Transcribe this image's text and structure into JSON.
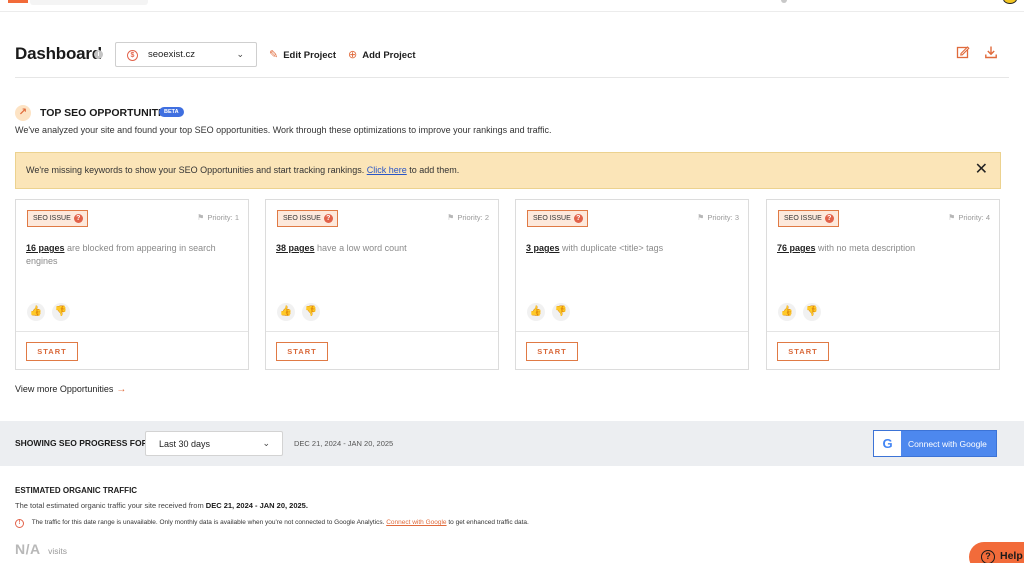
{
  "header": {
    "title": "Dashboard",
    "info_icon": "info-icon",
    "project": {
      "value": "seoexist.cz",
      "icon": "site-favicon-icon"
    },
    "edit_project": "Edit Project",
    "add_project": "Add Project",
    "report_icon": "edit-report-icon",
    "download_icon": "download-icon"
  },
  "opportunities": {
    "title": "TOP SEO OPPORTUNITIES",
    "beta": "BETA",
    "subtitle": "We've analyzed your site and found your top SEO opportunities. Work through these optimizations to improve your rankings and traffic.",
    "alert": {
      "text_before": "We're missing keywords to show your SEO Opportunities and start tracking rankings.",
      "link": "Click here",
      "text_after": "to add them."
    },
    "cards": [
      {
        "badge": "SEO ISSUE",
        "priority": "Priority: 1",
        "count": "16 pages",
        "text": "are blocked from appearing in search engines",
        "start": "START"
      },
      {
        "badge": "SEO ISSUE",
        "priority": "Priority: 2",
        "count": "38 pages",
        "text": "have a low word count",
        "start": "START"
      },
      {
        "badge": "SEO ISSUE",
        "priority": "Priority: 3",
        "count": "3 pages",
        "text": "with duplicate <title> tags",
        "start": "START"
      },
      {
        "badge": "SEO ISSUE",
        "priority": "Priority: 4",
        "count": "76 pages",
        "text": "with no meta description",
        "start": "START"
      }
    ],
    "view_more": "View more Opportunities"
  },
  "progress": {
    "label": "SHOWING SEO PROGRESS FOR:",
    "range": "Last 30 days",
    "dates": "DEC 21, 2024 - JAN 20, 2025",
    "connect": "Connect with Google"
  },
  "traffic": {
    "title": "ESTIMATED ORGANIC TRAFFIC",
    "subtitle_prefix": "The total estimated organic traffic your site received from",
    "subtitle_dates": "DEC 21, 2024 - JAN 20, 2025.",
    "warning_before": "The traffic for this date range is unavailable. Only monthly data is available when you're not connected to Google Analytics.",
    "warning_link": "Connect with Google",
    "warning_after": "to get enhanced traffic data.",
    "value": "N/A",
    "unit": "visits"
  },
  "help": {
    "label": "Help"
  },
  "colors": {
    "accent": "#e06a3b",
    "alert_bg": "#fbe5b8",
    "google_blue": "#4d88ee",
    "beta_blue": "#3f6fe0",
    "help_orange": "#f26b3a"
  }
}
